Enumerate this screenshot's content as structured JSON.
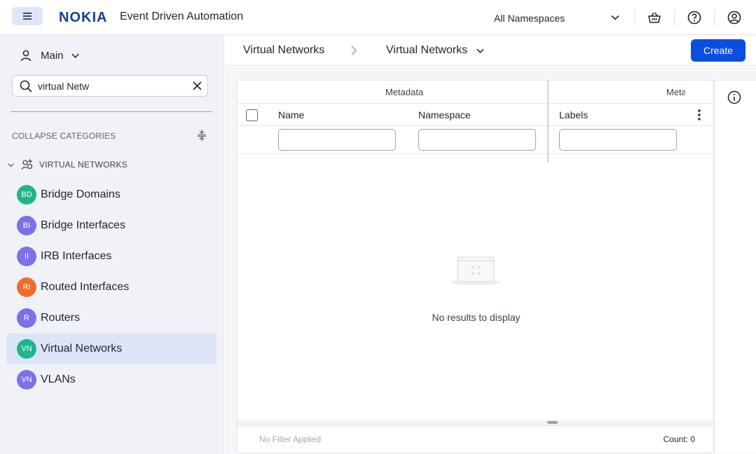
{
  "header": {
    "brand": "NOKIA",
    "app_title": "Event Driven Automation",
    "namespace": "All Namespaces",
    "icons": [
      "menu-icon",
      "chevron-down-icon",
      "basket-icon",
      "help-icon",
      "user-icon"
    ]
  },
  "sidebar": {
    "context": "Main",
    "search_value": "virtual Netw",
    "collapse_label": "COLLAPSE CATEGORIES",
    "category": "VIRTUAL NETWORKS",
    "items": [
      {
        "badge": "BD",
        "label": "Bridge Domains",
        "color": "#1fb58a"
      },
      {
        "badge": "BI",
        "label": "Bridge Interfaces",
        "color": "#7a72e8"
      },
      {
        "badge": "II",
        "label": "IRB Interfaces",
        "color": "#7a72e8"
      },
      {
        "badge": "RI",
        "label": "Routed Interfaces",
        "color": "#f26b2c"
      },
      {
        "badge": "R",
        "label": "Routers",
        "color": "#7a72e8"
      },
      {
        "badge": "VN",
        "label": "Virtual Networks",
        "color": "#1fb58a",
        "active": true
      },
      {
        "badge": "VN",
        "label": "VLANs",
        "color": "#7a72e8"
      }
    ]
  },
  "content": {
    "breadcrumb_parent": "Virtual Networks",
    "breadcrumb_current": "Virtual Networks",
    "create_label": "Create",
    "table": {
      "group_1": "Metadata",
      "group_2": "Meta",
      "columns": [
        "Name",
        "Namespace",
        "Labels"
      ],
      "empty_message": "No results to display",
      "filter_status": "No Filter Applied",
      "count": "Count: 0"
    }
  },
  "colors": {
    "accent": "#0a4fe0",
    "brand": "#124191",
    "sidebar_bg": "#f0f2f8",
    "active_item_bg": "#dce5f8"
  }
}
